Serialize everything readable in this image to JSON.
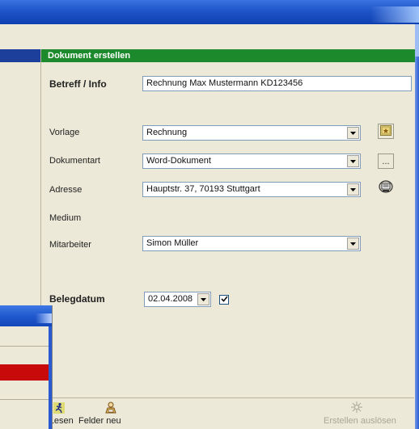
{
  "window": {
    "accent": "#1f55c8"
  },
  "section": {
    "title": "Dokument erstellen",
    "color": "#1c8a2c"
  },
  "form": {
    "betreff_label": "Betreff / Info",
    "betreff_value": "Rechnung Max Mustermann KD123456",
    "vorlage_label": "Vorlage",
    "vorlage_value": "Rechnung",
    "dokumentart_label": "Dokumentart",
    "dokumentart_value": "Word-Dokument",
    "dokumentart_button": "...",
    "adresse_label": "Adresse",
    "adresse_value": "Hauptstr. 37, 70193 Stuttgart",
    "medium_label": "Medium",
    "mitarbeiter_label": "Mitarbeiter",
    "mitarbeiter_value": "Simon Müller",
    "belegdatum_label": "Belegdatum",
    "belegdatum_value": "02.04.2008",
    "belegdatum_checked": true
  },
  "toolbar": {
    "lesen_label": "r Lesen",
    "felder_neu_label": "Felder neu",
    "erstellen_label": "Erstellen auslösen"
  },
  "icons": {
    "vorlage_button": "template-icon",
    "adresse_button": "address-book-icon",
    "lesen": "runner-icon",
    "felder_neu": "fields-icon",
    "erstellen": "sparkle-icon"
  },
  "subwindow": {
    "highlight_color": "#c80a0a"
  }
}
